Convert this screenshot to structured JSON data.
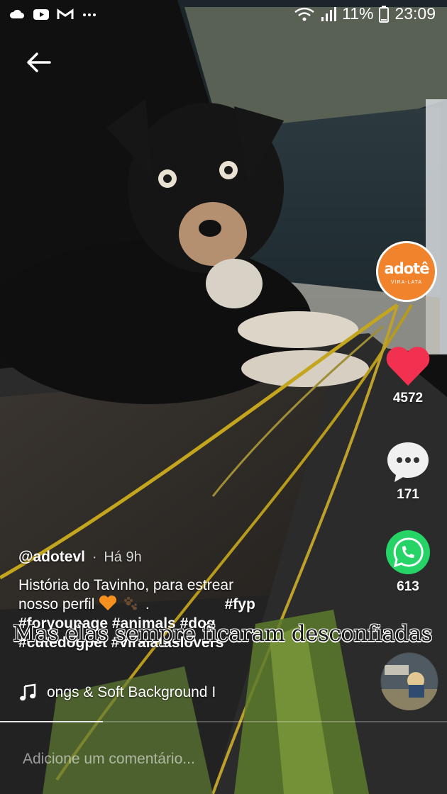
{
  "status_bar": {
    "battery_percent": "11%",
    "time": "23:09",
    "notification_icons": [
      "cloud-icon",
      "youtube-icon",
      "gmail-icon",
      "more-icon"
    ]
  },
  "brand_avatar": {
    "name": "adotê",
    "sub": "VIRA-LATA",
    "color": "#f1832c"
  },
  "actions": {
    "likes": "4572",
    "comments": "171",
    "shares": "613",
    "like_color": "#f2304f",
    "share_color": "#25d366"
  },
  "caption": {
    "author": "@adotevl",
    "separator": "·",
    "time": "Há 9h",
    "line1": "História do Tavinho, para estrear",
    "line2_text": "nosso perfil",
    "line2_tag": "#fyp",
    "line3": "#foryoupage #animals #dog",
    "line4": "#cutedogpet #viralataslovers"
  },
  "video_overlay_text": "Mas elas sempre ficaram desconfiadas",
  "music": {
    "track": "ongs & Soft Background I"
  },
  "progress": {
    "fraction": 0.23
  },
  "comment": {
    "placeholder": "Adicione um comentário..."
  }
}
